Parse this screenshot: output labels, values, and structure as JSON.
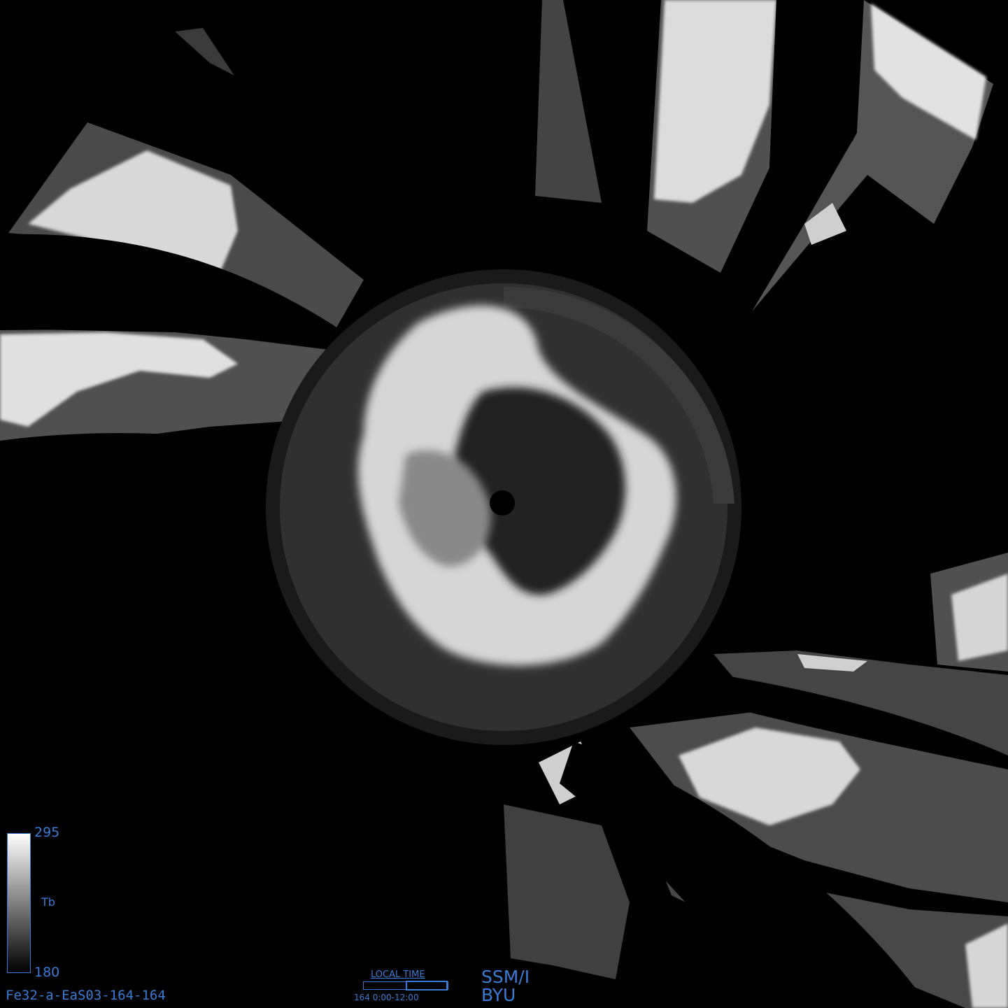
{
  "colorbar": {
    "max_label": "295",
    "min_label": "180",
    "variable_label": "Tb",
    "colors": [
      "#ffffff",
      "#000000"
    ],
    "border_color": "#3a7bd5"
  },
  "image_id_label": "Fe32-a-EaS03-164-164",
  "local_time": {
    "title": "LOCAL TIME",
    "range_label": "164  0:00-12:00",
    "window_fraction_start": 0.5,
    "window_fraction_end": 1.0
  },
  "sensor_label": "SSM/I",
  "org_label": "BYU",
  "label_color": "#3a7bd5"
}
